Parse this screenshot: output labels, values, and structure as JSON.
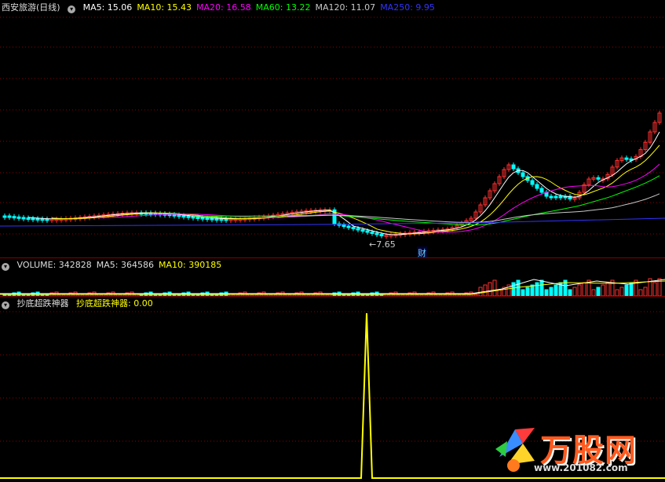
{
  "price_header": {
    "title": "西安旅游(日线)",
    "ma": [
      {
        "label": "MA5: 15.06",
        "color": "#ffffff"
      },
      {
        "label": "MA10: 15.43",
        "color": "#ffff00"
      },
      {
        "label": "MA20: 16.58",
        "color": "#ff00ff"
      },
      {
        "label": "MA60: 13.22",
        "color": "#00ff00"
      },
      {
        "label": "MA120: 11.07",
        "color": "#c8c8c8"
      },
      {
        "label": "MA250: 9.95",
        "color": "#3333ff"
      }
    ]
  },
  "price_annotations": {
    "low_label": "7.65",
    "event_label": "财"
  },
  "volume_header": {
    "items": [
      {
        "label": "VOLUME: 342828",
        "color": "#dddddd"
      },
      {
        "label": "MA5: 364586",
        "color": "#dddddd"
      },
      {
        "label": "MA10: 390185",
        "color": "#ffff00"
      }
    ]
  },
  "indicator_header": {
    "name": "抄底超跌神器",
    "value_label": "抄底超跌神器: 0.00",
    "value_color": "#ffff00"
  },
  "logo": {
    "text": "万股网",
    "url": "www.201082.com"
  },
  "colors": {
    "up": "#ff3030",
    "down": "#00ffff",
    "grid": "#8b0000",
    "signal": "#ffff00"
  }
}
